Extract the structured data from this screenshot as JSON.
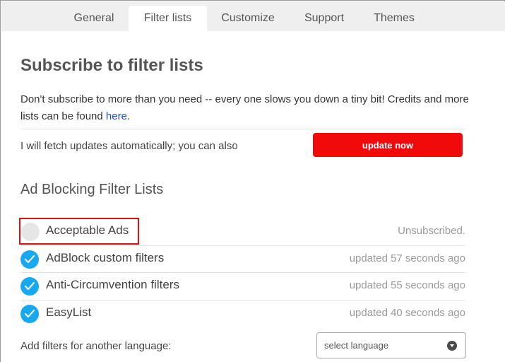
{
  "tabs": [
    {
      "label": "General",
      "active": false
    },
    {
      "label": "Filter lists",
      "active": true
    },
    {
      "label": "Customize",
      "active": false
    },
    {
      "label": "Support",
      "active": false
    },
    {
      "label": "Themes",
      "active": false
    }
  ],
  "header": {
    "title": "Subscribe to filter lists",
    "description_before_link": "Don't subscribe to more than you need -- every one slows you down a tiny bit! Credits and more lists can be found ",
    "description_link": "here",
    "description_after_link": "."
  },
  "update": {
    "text": "I will fetch updates automatically; you can also",
    "button_label": "update now"
  },
  "ad_blocking": {
    "heading": "Ad Blocking Filter Lists",
    "lists": [
      {
        "name": "Acceptable Ads",
        "status": "Unsubscribed.",
        "subscribed": false
      },
      {
        "name": "AdBlock custom filters",
        "status": "updated 57 seconds ago",
        "subscribed": true
      },
      {
        "name": "Anti-Circumvention filters",
        "status": "updated 55 seconds ago",
        "subscribed": true
      },
      {
        "name": "EasyList",
        "status": "updated 40 seconds ago",
        "subscribed": true
      }
    ]
  },
  "language": {
    "label": "Add filters for another language:",
    "select_value": "select language"
  },
  "colors": {
    "accent_red": "#f00a0a",
    "check_blue": "#18a8f0",
    "highlight_red": "#e01010",
    "link_blue": "#1a4fd6"
  }
}
